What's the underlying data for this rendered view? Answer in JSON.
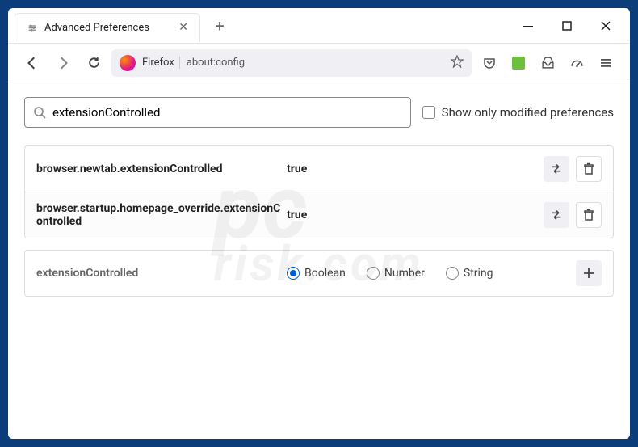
{
  "window": {
    "tab_title": "Advanced Preferences"
  },
  "toolbar": {
    "firefox_label": "Firefox",
    "url": "about:config"
  },
  "search": {
    "value": "extensionControlled",
    "checkbox_label": "Show only modified preferences"
  },
  "prefs": [
    {
      "name": "browser.newtab.extensionControlled",
      "value": "true"
    },
    {
      "name": "browser.startup.homepage_override.extensionControlled",
      "value": "true"
    }
  ],
  "add_row": {
    "name": "extensionControlled",
    "options": [
      "Boolean",
      "Number",
      "String"
    ],
    "selected": "Boolean"
  },
  "watermark": {
    "main": "pc",
    "sub": "risk.com"
  }
}
